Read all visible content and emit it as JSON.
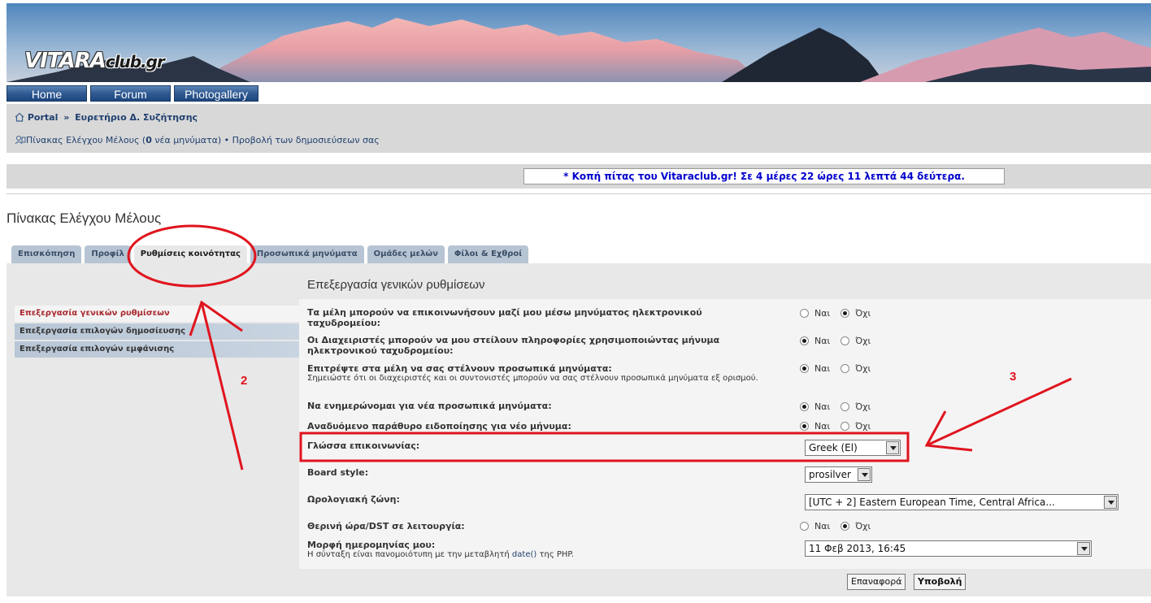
{
  "logo": {
    "brand": "VITARA",
    "suffix": "club.gr"
  },
  "topnav": {
    "home": "Home",
    "forum": "Forum",
    "photogallery": "Photogallery"
  },
  "breadcrumb": {
    "portal": "Portal",
    "separator": "»",
    "index": "Ευρετήριο Δ. Συζήτησης"
  },
  "ucp_line": {
    "panel": "Πίνακας Ελέγχου Μέλους (",
    "new_count": "0",
    "new_suffix": " νέα μηνύματα)",
    "bullet": "•",
    "view_posts": "Προβολή των δημοσιεύσεων σας"
  },
  "countdown": "* Κοπή πίτας του Vitaraclub.gr! Σε 4 μέρες 22 ώρες 11 λεπτά 44 δεύτερα.",
  "page_title": "Πίνακας Ελέγχου Μέλους",
  "tabs": [
    "Επισκόπηση",
    "Προφίλ",
    "Ρυθμίσεις κοινότητας",
    "Προσωπικά μηνύματα",
    "Ομάδες μελών",
    "Φίλοι & Εχθροί"
  ],
  "active_tab": "Ρυθμίσεις κοινότητας",
  "side_menu": [
    "Επεξεργασία γενικών ρυθμίσεων",
    "Επεξεργασία επιλογών δημοσίευσης",
    "Επεξεργασία επιλογών εμφάνισης"
  ],
  "form_title": "Επεξεργασία γενικών ρυθμίσεων",
  "yes": "Ναι",
  "no": "Όχι",
  "settings": [
    {
      "label": "Τα μέλη μπορούν να επικοινωνήσουν μαζί μου μέσω μηνύματος ηλεκτρονικού ταχυδρομείου:",
      "value": "no"
    },
    {
      "label": "Οι Διαχειριστές μπορούν να μου στείλουν πληροφορίες χρησιμοποιώντας μήνυμα ηλεκτρονικού ταχυδρομείου:",
      "value": "yes"
    },
    {
      "label": "Επιτρέψτε στα μέλη να σας στέλνουν προσωπικά μηνύματα:",
      "note": "Σημειώστε ότι οι διαχειριστές και οι συντονιστές μπορούν να σας στέλνουν προσωπικά μηνύματα εξ ορισμού.",
      "value": "yes"
    },
    {
      "label": "Να ενημερώνομαι για νέα προσωπικά μηνύματα:",
      "value": "yes"
    },
    {
      "label": "Αναδυόμενο παράθυρο ειδοποίησης για νέο μήνυμα:",
      "value": "yes"
    }
  ],
  "language": {
    "label": "Γλώσσα επικοινωνίας:",
    "value": "Greek (El)"
  },
  "board_style": {
    "label": "Board style:",
    "value": "prosilver"
  },
  "timezone": {
    "label": "Ωρολογιακή ζώνη:",
    "value": "[UTC + 2] Eastern European Time, Central Africa..."
  },
  "dst": {
    "label": "Θερινή ώρα/DST σε λειτουργία:",
    "value": "no"
  },
  "date_format": {
    "label": "Μορφή ημερομηνίας μου:",
    "note_prefix": "Η σύνταξη είναι πανομοιότυπη με την μεταβλητή ",
    "note_link": "date()",
    "note_suffix": " της PHP.",
    "value": "11 Φεβ 2013, 16:45"
  },
  "buttons": {
    "reset": "Επαναφορά",
    "submit": "Υποβολή"
  },
  "annotations": {
    "two": "2",
    "three": "3",
    "color": "#e0141e"
  }
}
